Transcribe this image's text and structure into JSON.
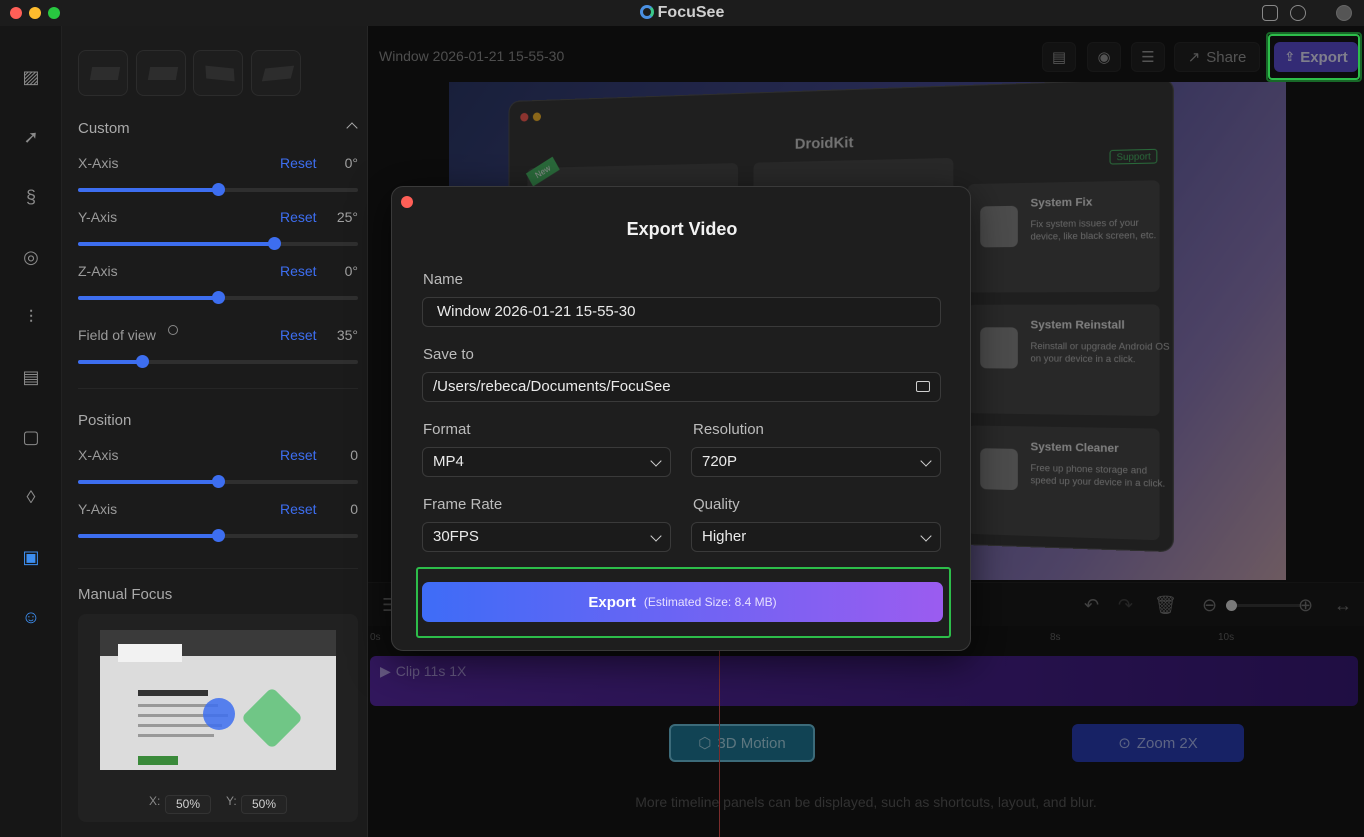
{
  "app": {
    "title": "FocuSee"
  },
  "panel": {
    "custom_title": "Custom",
    "position_title": "Position",
    "manual_focus_title": "Manual Focus",
    "reset_label": "Reset",
    "rows": [
      {
        "label": "X-Axis",
        "value": "0°",
        "level": 0.5
      },
      {
        "label": "Y-Axis",
        "value": "25°",
        "level": 0.7
      },
      {
        "label": "Z-Axis",
        "value": "0°",
        "level": 0.5
      },
      {
        "label": "Field of view",
        "value": "35°",
        "level": 0.23
      }
    ],
    "position_rows": [
      {
        "label": "X-Axis",
        "value": "0",
        "level": 0.5
      },
      {
        "label": "Y-Axis",
        "value": "0",
        "level": 0.5
      }
    ],
    "focus": {
      "x_label": "X:",
      "x_value": "50%",
      "y_label": "Y:",
      "y_value": "50%"
    }
  },
  "main": {
    "doc_title": "Window 2026-01-21 15-55-30",
    "share_label": "Share",
    "export_label": "Export"
  },
  "preview": {
    "window_title": "DroidKit",
    "support_label": "Support",
    "new_badge": "New",
    "cards": [
      {
        "title": "System Fix",
        "desc": "Fix system issues of your device, like black screen, etc."
      },
      {
        "title": "System Reinstall",
        "desc": "Reinstall or upgrade Android OS on your device in a click."
      },
      {
        "title": "System Cleaner",
        "desc": "Free up phone storage and speed up your device in a click."
      }
    ]
  },
  "timeline": {
    "ticks": [
      "0s",
      "8s",
      "10s"
    ],
    "clip_label": "Clip 11s  1X",
    "chip_3d": "3D Motion",
    "chip_zoom": "Zoom 2X",
    "hint": "More timeline panels can be displayed, such as shortcuts, layout, and blur."
  },
  "modal": {
    "title": "Export Video",
    "name_label": "Name",
    "name_value": "Window 2026-01-21 15-55-30",
    "save_label": "Save to",
    "save_value": "/Users/rebeca/Documents/FocuSee",
    "format_label": "Format",
    "format_value": "MP4",
    "resolution_label": "Resolution",
    "resolution_value": "720P",
    "framerate_label": "Frame Rate",
    "framerate_value": "30FPS",
    "quality_label": "Quality",
    "quality_value": "Higher",
    "export_label": "Export",
    "export_size": "(Estimated Size: 8.4 MB)"
  },
  "colors": {
    "accent": "#3d6ef0",
    "export_button": "#5e4fd6",
    "highlight": "#2dbd4a"
  }
}
